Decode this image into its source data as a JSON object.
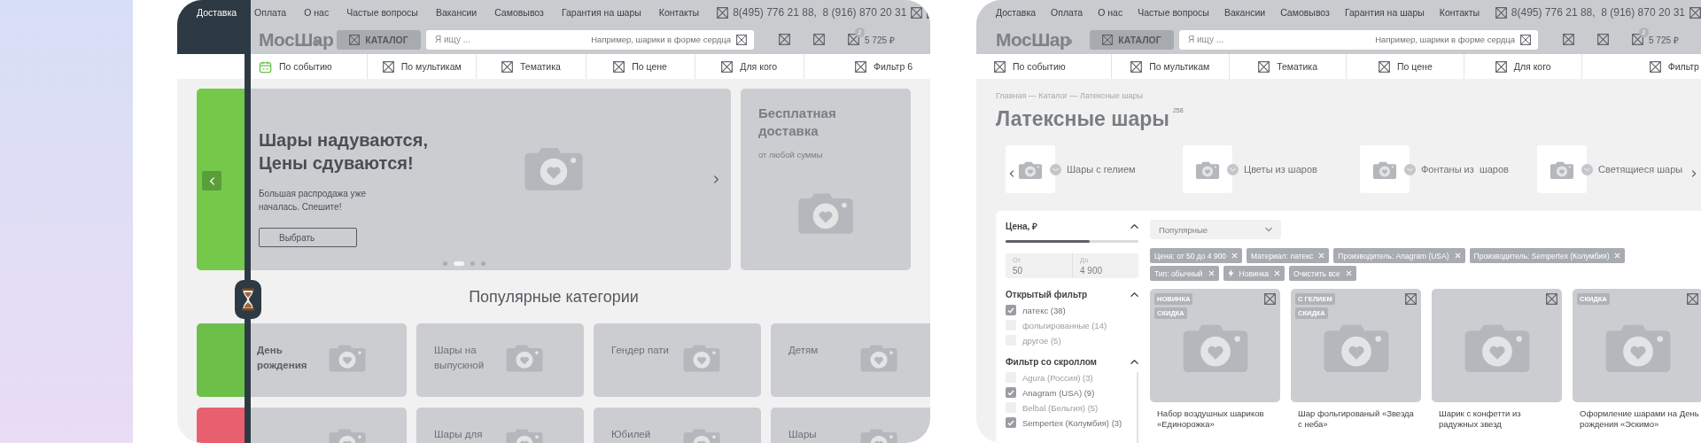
{
  "left_page": {
    "header": {
      "links": [
        "Доставка",
        "Оплата",
        "О нас",
        "Частые вопросы",
        "Вакансии",
        "Самовывоз",
        "Гарантия на шары",
        "Контакты"
      ],
      "phone": "8(495) 776 21 88,  8 (916) 870 20 31",
      "logo": "МосШар",
      "catalog_button": "КАТАЛОГ",
      "search": {
        "placeholder": "Я ищу ...",
        "hint": "Например, шарики в форме сердца"
      },
      "cart": {
        "count": "2",
        "total": "5 725 ₽"
      },
      "filters": [
        {
          "label": "По событию",
          "kind": "calendar"
        },
        {
          "label": "По мультикам",
          "kind": "placeholder"
        },
        {
          "label": "Тематика",
          "kind": "placeholder"
        },
        {
          "label": "По цене",
          "kind": "placeholder"
        },
        {
          "label": "Для кого",
          "kind": "placeholder"
        },
        {
          "label": "Фильтр 6",
          "kind": "placeholder"
        }
      ]
    },
    "banner": {
      "title_lines": [
        "Шары надуваются,",
        "Цены сдуваются!"
      ],
      "text": "Большая распродажа уже началась. Спешите!",
      "button": "Выбрать",
      "dots": [
        {
          "selected": false
        },
        {
          "selected": true
        },
        {
          "selected": false
        },
        {
          "selected": false
        }
      ]
    },
    "side_card": {
      "title": "Бесплатная доставка",
      "text": "от любой суммы"
    },
    "categories_title": "Популярные категории",
    "categories": [
      {
        "label": "День рождения",
        "color": "#6cc04a"
      },
      {
        "label": "Шары на выпускной"
      },
      {
        "label": "Гендер пати"
      },
      {
        "label": "Детям"
      },
      {
        "color": "#e8606f"
      },
      {
        "label": "Шары для"
      },
      {
        "label": "Юбилей"
      },
      {
        "label": "Шары"
      }
    ]
  },
  "right_page": {
    "header": {
      "links": [
        "Доставка",
        "Оплата",
        "О нас",
        "Частые вопросы",
        "Вакансии",
        "Самовывоз",
        "Гарантия на шары",
        "Контакты"
      ],
      "phone": "8(495) 776 21 88,  8 (916) 870 20 31",
      "logo": "МосШар",
      "catalog_button": "КАТАЛОГ",
      "search": {
        "placeholder": "Я ищу ...",
        "hint": "Например, шарики в форме сердца"
      },
      "cart": {
        "count": "2",
        "total": "5 725 ₽"
      },
      "filters": [
        {
          "label": "По событию",
          "kind": "placeholder"
        },
        {
          "label": "По мультикам",
          "kind": "placeholder"
        },
        {
          "label": "Тематика",
          "kind": "placeholder"
        },
        {
          "label": "По цене",
          "kind": "placeholder"
        },
        {
          "label": "Для кого",
          "kind": "placeholder"
        },
        {
          "label": "Фильтр",
          "kind": "placeholder"
        }
      ]
    },
    "breadcrumb": "Главная — Каталог — Латексные шары",
    "title": "Латексные шары",
    "count": "258",
    "subcategories": [
      "Шары с гелием",
      "Цветы из шаров",
      "Фонтаны из  шаров",
      "Светящиеся шары"
    ],
    "price_filter": {
      "title": "Цена, ₽",
      "expanded": true,
      "level": 0.63,
      "from": {
        "label": "От",
        "value": "50"
      },
      "to": {
        "label": "До",
        "value": "4 900"
      }
    },
    "groups": [
      {
        "title": "Открытый фильтр",
        "expanded": true,
        "options": [
          {
            "label": "латекс (38)",
            "checked": true
          },
          {
            "label": "фольгированные (14)",
            "checked": false
          },
          {
            "label": "другое (5)",
            "checked": false
          }
        ]
      },
      {
        "title": "Фильтр со скроллом",
        "expanded": true,
        "options": [
          {
            "label": "Agura (Россия) (3)",
            "checked": false
          },
          {
            "label": "Anagram (USA) (9)",
            "checked": true
          },
          {
            "label": "Belbal (Бельгия) (5)",
            "checked": false
          },
          {
            "label": "Sempertex (Колумбия) (3)",
            "checked": true
          }
        ]
      }
    ],
    "sort": "Популярные",
    "chips": [
      {
        "label": "Цена: от 50 до 4 900",
        "kind": "filter"
      },
      {
        "label": "Материал: латекс",
        "kind": "filter"
      },
      {
        "label": "Производитель: Anagram (USA)",
        "kind": "filter"
      },
      {
        "label": "Производитель: Sempertex (Колумбия)",
        "kind": "filter"
      },
      {
        "label": "Тип: обычный",
        "kind": "filter"
      },
      {
        "label": "Новинка",
        "kind": "new"
      },
      {
        "label": "Очистить все",
        "kind": "clear"
      }
    ],
    "products": [
      {
        "tags": [
          "НОВИНКА",
          "СКИДКА"
        ],
        "title": "Набор воздушных шариков «Единорожка»"
      },
      {
        "tags": [
          "С ГЕЛИЕМ",
          "СКИДКА"
        ],
        "title": "Шар фольгированый «Звезда с неба»"
      },
      {
        "title": "Шарик с конфетти из радужных звезд"
      },
      {
        "tags": [
          "СКИДКА"
        ],
        "title": "Оформление шарами на День рождения «Эскимо»"
      }
    ]
  }
}
